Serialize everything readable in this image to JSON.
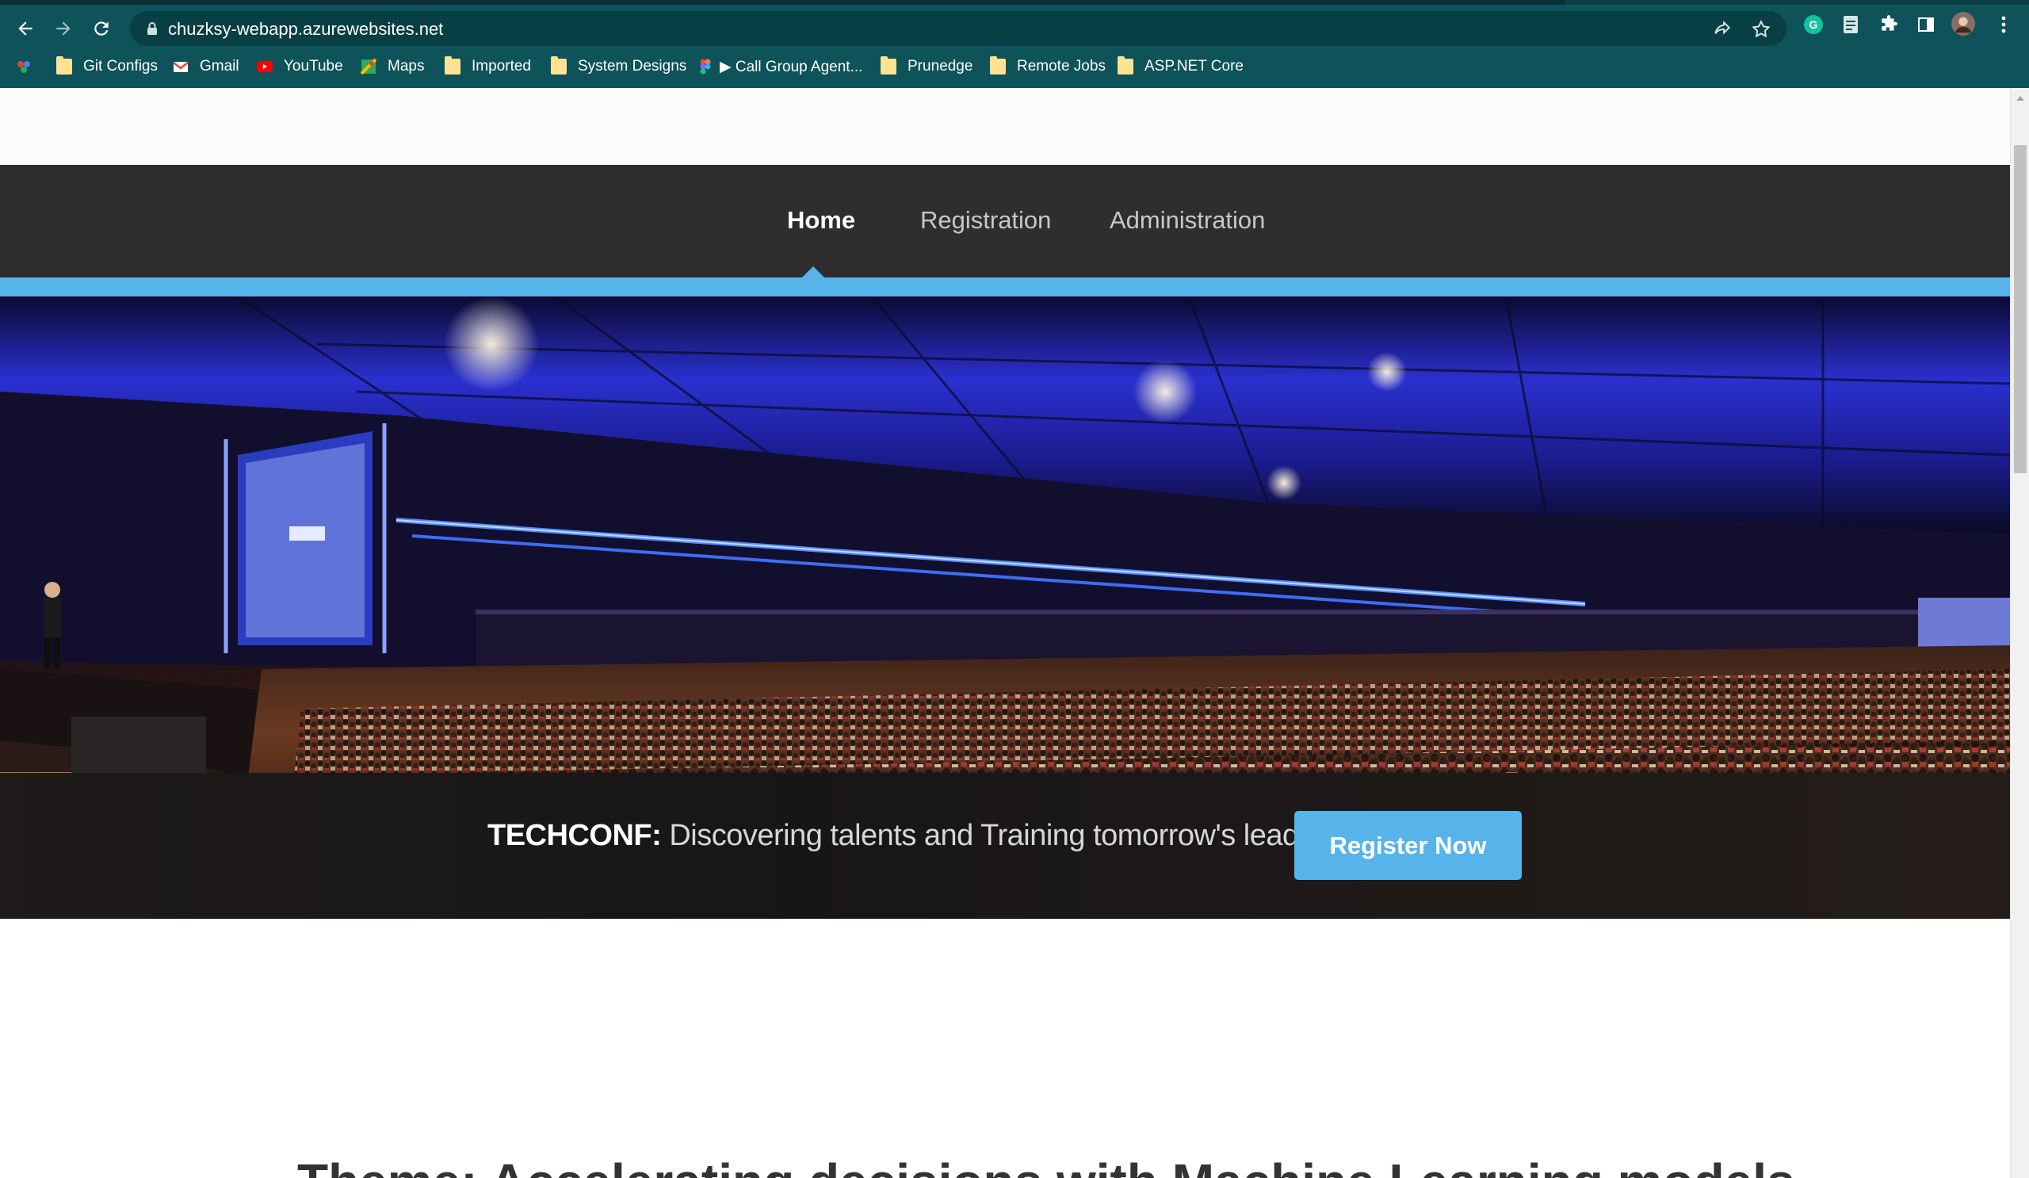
{
  "browser": {
    "url": "chuzksy-webapp.azurewebsites.net",
    "bookmarks": [
      {
        "label": "",
        "icon": "apps-icon"
      },
      {
        "label": "Git Configs",
        "icon": "folder-icon"
      },
      {
        "label": "Gmail",
        "icon": "gmail-icon"
      },
      {
        "label": "YouTube",
        "icon": "youtube-icon"
      },
      {
        "label": "Maps",
        "icon": "maps-icon"
      },
      {
        "label": "Imported",
        "icon": "folder-icon"
      },
      {
        "label": "System Designs",
        "icon": "folder-icon"
      },
      {
        "label": "▶ Call Group Agent...",
        "icon": "figma-icon"
      },
      {
        "label": "Prunedge",
        "icon": "folder-icon"
      },
      {
        "label": "Remote Jobs",
        "icon": "folder-icon"
      },
      {
        "label": "ASP.NET Core",
        "icon": "folder-icon"
      }
    ]
  },
  "nav": {
    "items": [
      {
        "label": "Home",
        "active": true
      },
      {
        "label": "Registration",
        "active": false
      },
      {
        "label": "Administration",
        "active": false
      }
    ]
  },
  "banner": {
    "brand": "TECHCONF:",
    "tagline": " Discovering talents and Training tomorrow's leaders",
    "cta": "Register Now"
  },
  "section": {
    "heading": "Theme: Accelerating decisions with Machine Learning models"
  },
  "colors": {
    "chrome": "#0d5359",
    "accent": "#56b4ea",
    "navbar": "#2e2e2e"
  }
}
